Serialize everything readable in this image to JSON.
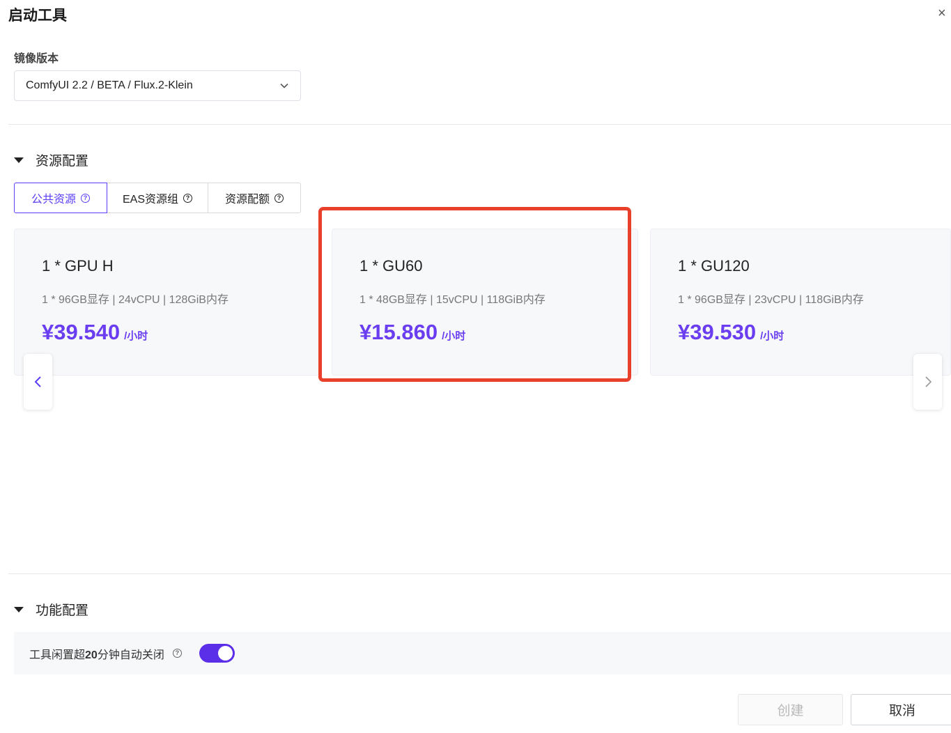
{
  "dialog": {
    "title": "启动工具",
    "close_glyph": "×"
  },
  "image_version": {
    "label": "镜像版本",
    "selected": "ComfyUI 2.2 / BETA / Flux.2-Klein"
  },
  "resource_config": {
    "title": "资源配置",
    "tabs": [
      {
        "label": "公共资源",
        "active": true
      },
      {
        "label": "EAS资源组",
        "active": false
      },
      {
        "label": "资源配额",
        "active": false
      }
    ],
    "help_glyph": "?",
    "cards": [
      {
        "name": "1 * GPU H",
        "spec": "1 * 96GB显存 | 24vCPU | 128GiB内存",
        "price": "¥39.540",
        "unit": "/小时"
      },
      {
        "name": "1 * GU60",
        "spec": "1 * 48GB显存 | 15vCPU | 118GiB内存",
        "price": "¥15.860",
        "unit": "/小时"
      },
      {
        "name": "1 * GU120",
        "spec": "1 * 96GB显存 | 23vCPU | 118GiB内存",
        "price": "¥39.530",
        "unit": "/小时"
      }
    ]
  },
  "feature_config": {
    "title": "功能配置",
    "auto_shutdown": {
      "label_prefix": "工具闲置超",
      "label_num": "20",
      "label_suffix": "分钟自动关闭",
      "enabled": true
    }
  },
  "footer": {
    "create_label": "创建",
    "cancel_label": "取消"
  },
  "colors": {
    "accent": "#5b3df5",
    "price": "#6a3ef0",
    "highlight": "#e8402a",
    "toggle_on": "#5b2ee8"
  },
  "icons": {
    "close": "close-icon",
    "dropdown": "chevron-down-icon",
    "collapse": "caret-down-icon",
    "help": "question-circle-icon",
    "prev": "chevron-left-icon",
    "next": "chevron-right-icon"
  }
}
